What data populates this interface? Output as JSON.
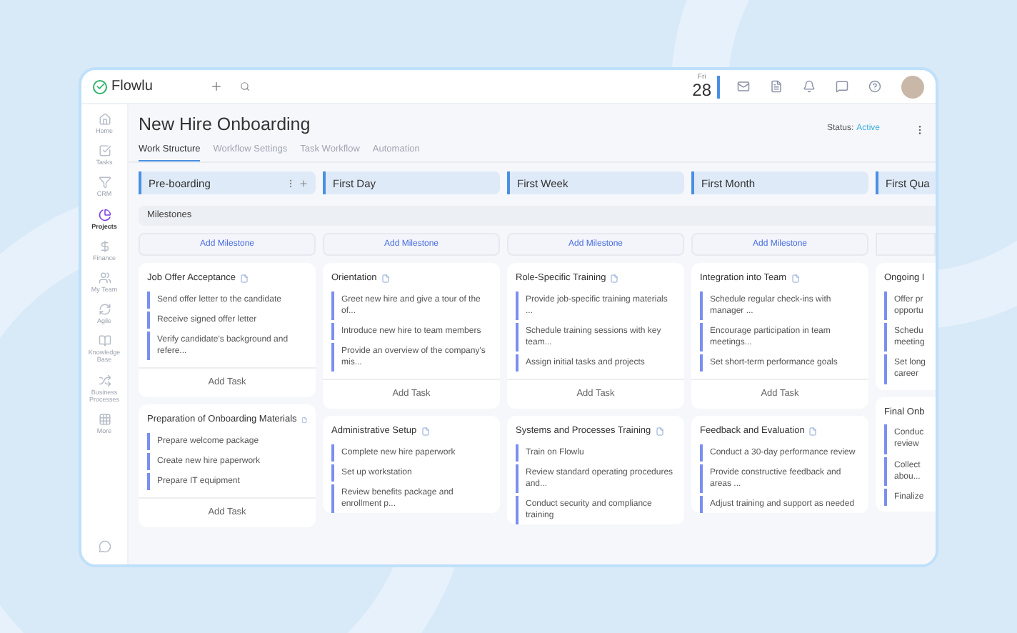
{
  "app": {
    "logo": "Flowlu",
    "date_day": "Fri",
    "date_num": "28"
  },
  "sidebar": {
    "items": [
      {
        "label": "Home",
        "selected": false
      },
      {
        "label": "Tasks",
        "selected": false
      },
      {
        "label": "CRM",
        "selected": false
      },
      {
        "label": "Projects",
        "selected": true
      },
      {
        "label": "Finance",
        "selected": false
      },
      {
        "label": "My Team",
        "selected": false
      },
      {
        "label": "Agile",
        "selected": false
      },
      {
        "label": "Knowledge Base",
        "selected": false
      },
      {
        "label": "Business Processes",
        "selected": false
      },
      {
        "label": "More",
        "selected": false
      }
    ]
  },
  "project": {
    "title": "New Hire Onboarding",
    "status_label": "Status:",
    "status": "Active"
  },
  "tabs": [
    {
      "label": "Work Structure",
      "selected": true
    },
    {
      "label": "Workflow Settings",
      "selected": false
    },
    {
      "label": "Task Workflow",
      "selected": false
    },
    {
      "label": "Automation",
      "selected": false
    }
  ],
  "milestones_label": "Milestones",
  "columns": [
    {
      "title": "Pre-boarding",
      "actions": true,
      "milestone_button": "Add Milestone",
      "cards": [
        {
          "title": "Job Offer Acceptance",
          "tasks": [
            "Send offer letter to the candidate",
            "Receive signed offer letter",
            "Verify candidate's background and refere..."
          ],
          "add_task": "Add Task"
        },
        {
          "title": "Preparation of Onboarding Materials",
          "tasks": [
            "Prepare welcome package",
            "Create new hire paperwork",
            "Prepare IT equipment"
          ],
          "add_task": "Add Task"
        }
      ]
    },
    {
      "title": "First Day",
      "actions": false,
      "milestone_button": "Add Milestone",
      "cards": [
        {
          "title": "Orientation",
          "tasks": [
            "Greet new hire and give a tour of the of...",
            "Introduce new hire to team members",
            "Provide an overview of the company's mis..."
          ],
          "add_task": "Add Task"
        },
        {
          "title": "Administrative Setup",
          "tasks": [
            "Complete new hire paperwork",
            "Set up workstation",
            "Review benefits package and enrollment p..."
          ]
        }
      ]
    },
    {
      "title": "First Week",
      "actions": false,
      "milestone_button": "Add Milestone",
      "cards": [
        {
          "title": "Role-Specific Training",
          "tasks": [
            "Provide job-specific training materials ...",
            "Schedule training sessions with key team...",
            "Assign initial tasks and projects"
          ],
          "add_task": "Add Task"
        },
        {
          "title": "Systems and Processes Training",
          "tasks": [
            "Train on Flowlu",
            "Review standard operating procedures and...",
            "Conduct security and compliance training"
          ]
        }
      ]
    },
    {
      "title": "First Month",
      "actions": false,
      "milestone_button": "Add Milestone",
      "cards": [
        {
          "title": "Integration into Team",
          "tasks": [
            "Schedule regular check-ins with manager ...",
            "Encourage participation in team meetings...",
            "Set short-term performance goals"
          ],
          "add_task": "Add Task"
        },
        {
          "title": "Feedback and Evaluation",
          "tasks": [
            "Conduct a 30-day performance review",
            "Provide constructive feedback and areas ...",
            "Adjust training and support as needed"
          ]
        }
      ]
    },
    {
      "title": "First Qua",
      "cards": [
        {
          "title": "Ongoing I",
          "tasks": [
            "Offer pr opportu",
            "Schedu meeting",
            "Set long career"
          ]
        },
        {
          "title": "Final Onb",
          "tasks": [
            "Conduc review",
            "Collect abou...",
            "Finalize"
          ]
        }
      ]
    }
  ]
}
